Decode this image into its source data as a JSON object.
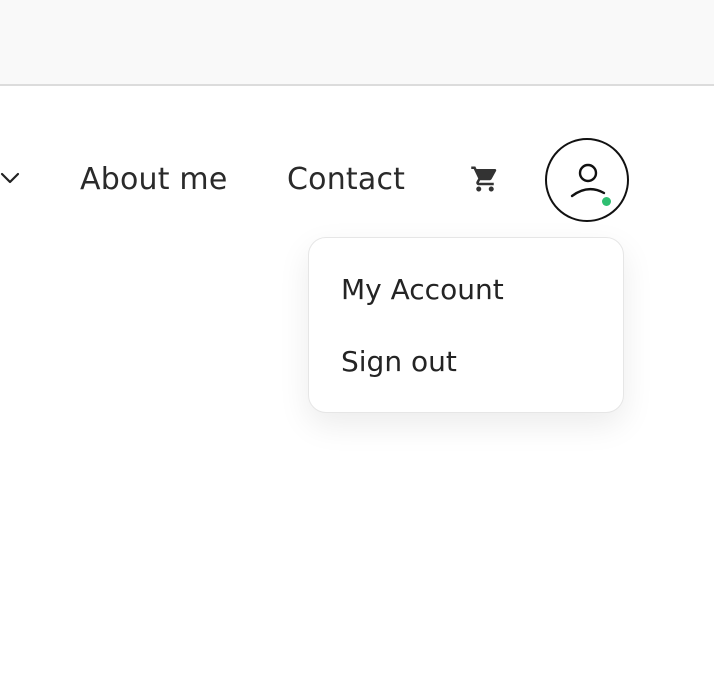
{
  "nav": {
    "about_label": "About me",
    "contact_label": "Contact",
    "cart_icon": "cart-icon",
    "chevron_icon": "chevron-down-icon"
  },
  "user_menu": {
    "avatar_icon": "user-icon",
    "status": "online",
    "status_color": "#2fbf71",
    "items": [
      {
        "label": "My Account"
      },
      {
        "label": "Sign out"
      }
    ]
  },
  "colors": {
    "topbar_bg": "#f9f9f9",
    "text": "#2a2a2a",
    "border": "#111111"
  }
}
